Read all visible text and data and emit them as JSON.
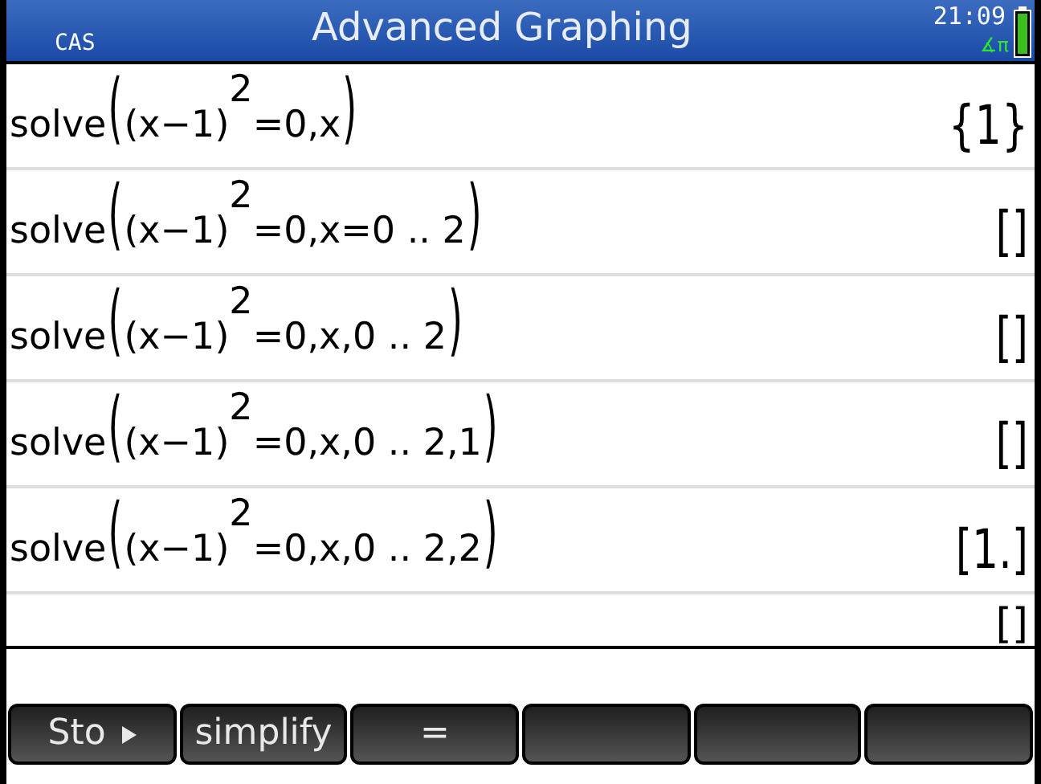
{
  "header": {
    "mode": "CAS",
    "title": "Advanced Graphing",
    "time": "21:09",
    "angle_mode": "∡π"
  },
  "history": [
    {
      "function": "solve",
      "open": "(",
      "base": "(x−1)",
      "exponent": "2",
      "rest": "=0,x",
      "close": ")",
      "result": "{1}"
    },
    {
      "function": "solve",
      "open": "(",
      "base": "(x−1)",
      "exponent": "2",
      "rest": "=0,x=0 .. 2",
      "close": ")",
      "result": "[]"
    },
    {
      "function": "solve",
      "open": "(",
      "base": "(x−1)",
      "exponent": "2",
      "rest": "=0,x,0 .. 2",
      "close": ")",
      "result": "[]"
    },
    {
      "function": "solve",
      "open": "(",
      "base": "(x−1)",
      "exponent": "2",
      "rest": "=0,x,0 .. 2,1",
      "close": ")",
      "result": "[]"
    },
    {
      "function": "solve",
      "open": "(",
      "base": "(x−1)",
      "exponent": "2",
      "rest": "=0,x,0 .. 2,2",
      "close": ")",
      "result": "[1.]"
    }
  ],
  "partial_result": "[]",
  "menu": [
    {
      "label": "Sto",
      "kind": "arrow"
    },
    {
      "label": "simplify",
      "kind": "plain"
    },
    {
      "label": "=",
      "kind": "plain"
    },
    {
      "kind": "empty"
    },
    {
      "kind": "empty"
    },
    {
      "kind": "empty"
    }
  ]
}
